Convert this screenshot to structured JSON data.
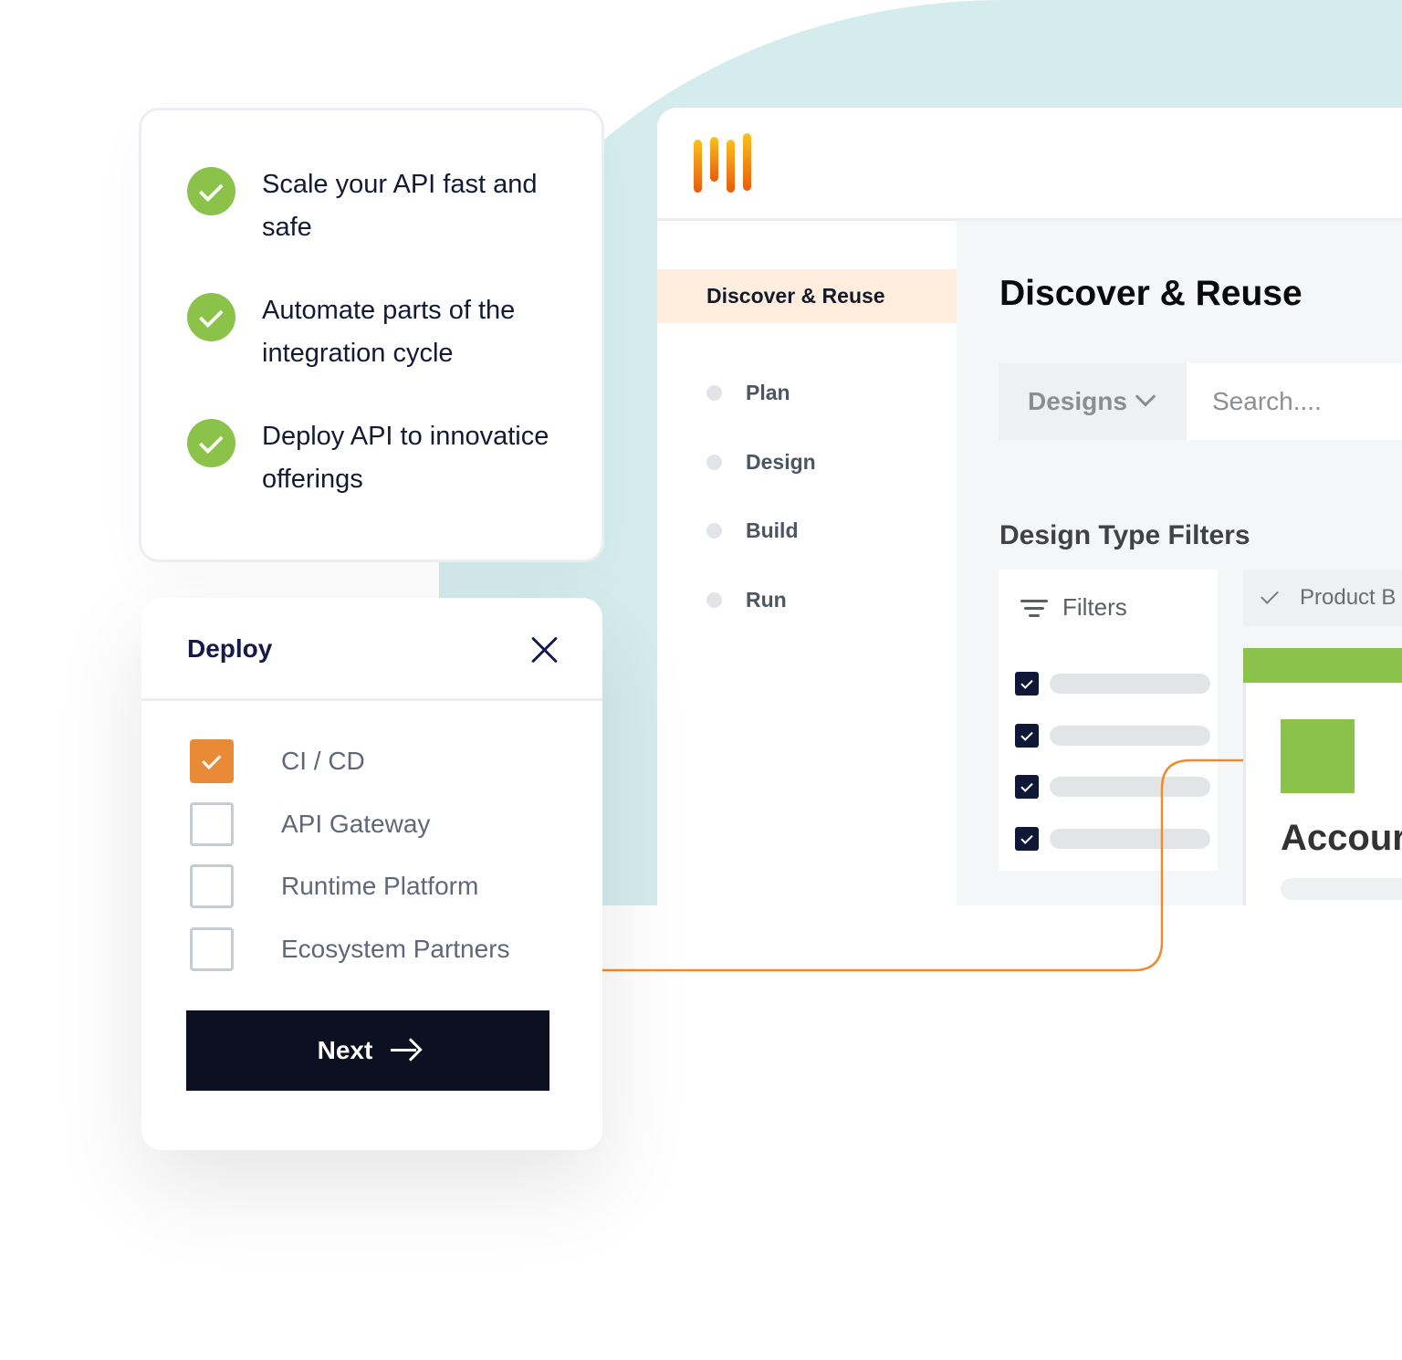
{
  "benefits": {
    "items": [
      {
        "text": "Scale your API fast and safe"
      },
      {
        "text": "Automate parts of the integration cycle"
      },
      {
        "text": "Deploy API to innovatice offerings"
      }
    ]
  },
  "deploy_panel": {
    "title": "Deploy",
    "close_icon": "close-icon",
    "options": [
      {
        "label": "CI / CD",
        "checked": true
      },
      {
        "label": "API Gateway",
        "checked": false
      },
      {
        "label": "Runtime Platform",
        "checked": false
      },
      {
        "label": "Ecosystem Partners",
        "checked": false
      }
    ],
    "next_label": "Next",
    "next_icon": "arrow-right-icon"
  },
  "app": {
    "logo_icon": "bars-logo-icon",
    "sidebar": {
      "active_item": "Discover & Reuse",
      "items": [
        {
          "label": "Plan"
        },
        {
          "label": "Design"
        },
        {
          "label": "Build"
        },
        {
          "label": "Run"
        }
      ]
    },
    "main": {
      "title": "Discover & Reuse",
      "type_select": "Designs",
      "search_placeholder": "Search....",
      "filters_title": "Design Type Filters",
      "filters_label": "Filters",
      "filter_rows_checked": [
        true,
        true,
        true,
        true
      ],
      "chip_label": "Product B",
      "card_title": "Accour"
    }
  },
  "colors": {
    "accent_orange": "#e98b36",
    "accent_green": "#8bc34a",
    "navy": "#0d1020",
    "teal_bg": "#d5ecee",
    "active_highlight": "#ffeedd"
  }
}
